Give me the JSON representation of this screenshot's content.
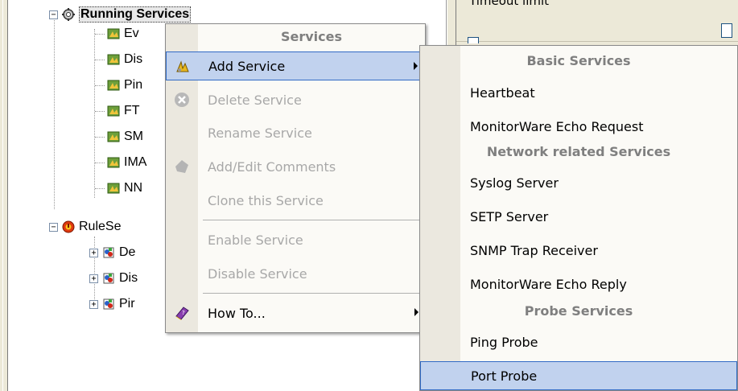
{
  "right_pane": {
    "timeout_label": "Timeout limit"
  },
  "tree": {
    "running_services_label": "Running Services",
    "service_children": [
      "Ev",
      "Dis",
      "Pin",
      "FT",
      "SM",
      "IMA",
      "NN"
    ],
    "ruleset_label": "RuleSe",
    "ruleset_children": [
      "De",
      "Dis",
      "Pir"
    ]
  },
  "context_menu": {
    "header": "Services",
    "items": [
      {
        "label": "Add Service",
        "icon": "add-service-icon",
        "disabled": false,
        "submenu": true,
        "highlighted": true
      },
      {
        "label": "Delete Service",
        "icon": "delete-icon",
        "disabled": true
      },
      {
        "label": "Rename Service",
        "icon": "",
        "disabled": true
      },
      {
        "label": "Add/Edit Comments",
        "icon": "comment-icon",
        "disabled": true
      },
      {
        "label": "Clone this Service",
        "icon": "",
        "disabled": true
      },
      {
        "label": "Enable Service",
        "icon": "",
        "disabled": true
      },
      {
        "label": "Disable Service",
        "icon": "",
        "disabled": true
      },
      {
        "label": "How To...",
        "icon": "help-book-icon",
        "disabled": false,
        "submenu": true
      }
    ]
  },
  "submenu": {
    "sections": [
      {
        "header": "Basic Services",
        "items": [
          "Heartbeat",
          "MonitorWare Echo Request"
        ]
      },
      {
        "header": "Network related Services",
        "items": [
          "Syslog Server",
          "SETP Server",
          "SNMP Trap Receiver",
          "MonitorWare Echo Reply"
        ]
      },
      {
        "header": "Probe Services",
        "items": [
          "Ping Probe",
          "Port Probe"
        ]
      }
    ],
    "highlighted_item": "Port Probe"
  },
  "colors": {
    "menu_highlight": "#c1d2ee",
    "menu_highlight_border": "#316ac5",
    "disabled_text": "#a8a8a8",
    "header_text": "#7f7f7f"
  }
}
